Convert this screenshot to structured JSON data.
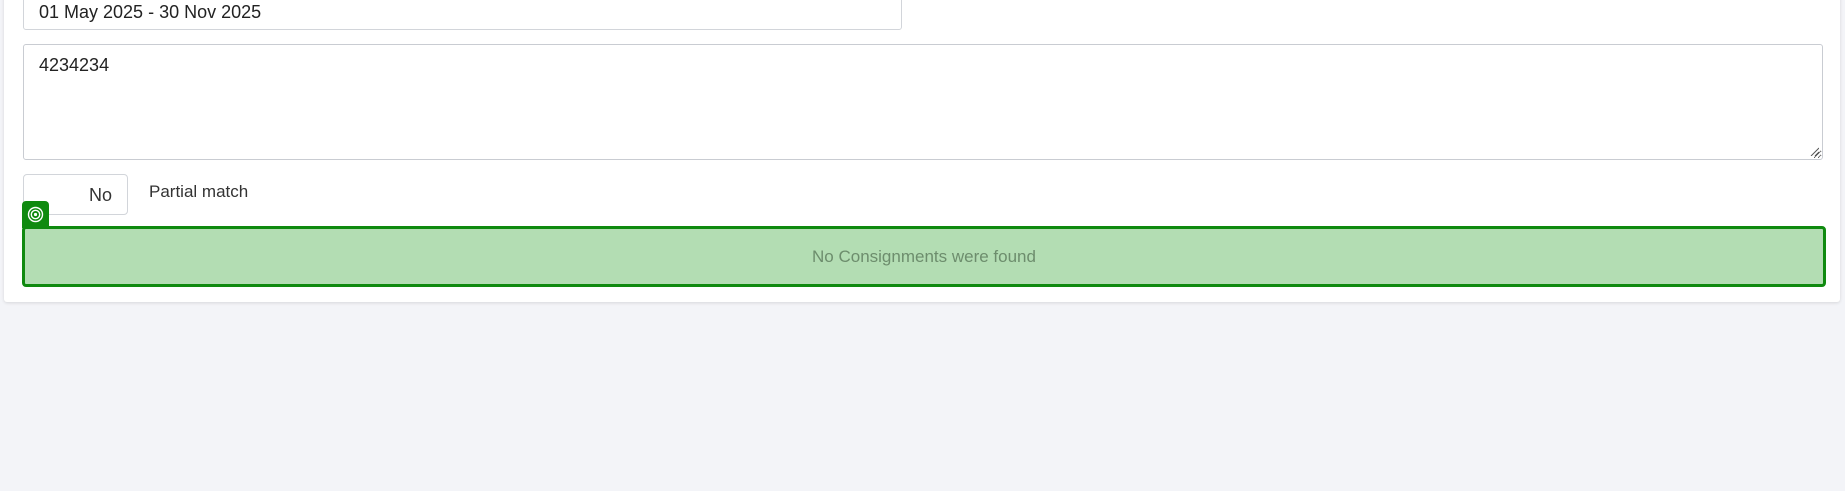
{
  "filters": {
    "date_range": "01 May 2025 - 30 Nov 2025",
    "search_text": "4234234",
    "partial_match": {
      "value": "No",
      "label": "Partial match"
    }
  },
  "result": {
    "message": "No Consignments were found",
    "icon": "target-icon"
  },
  "colors": {
    "page_background": "#f3f4f8",
    "success_border": "#0f8a0f",
    "success_background": "#b3ddb3",
    "success_text": "#6d8d6d"
  }
}
